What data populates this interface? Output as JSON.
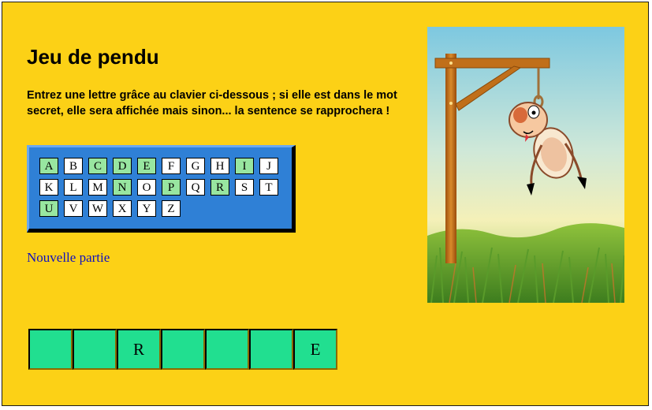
{
  "title": "Jeu de pendu",
  "instructions": "Entrez une lettre grâce au clavier ci-dessous ; si elle est dans le mot secret, elle sera affichée mais sinon... la sentence se rapprochera !",
  "keyboard": {
    "rows": [
      [
        {
          "letter": "A",
          "used": true
        },
        {
          "letter": "B",
          "used": false
        },
        {
          "letter": "C",
          "used": true
        },
        {
          "letter": "D",
          "used": true
        },
        {
          "letter": "E",
          "used": true
        },
        {
          "letter": "F",
          "used": false
        },
        {
          "letter": "G",
          "used": false
        },
        {
          "letter": "H",
          "used": false
        },
        {
          "letter": "I",
          "used": true
        },
        {
          "letter": "J",
          "used": false
        }
      ],
      [
        {
          "letter": "K",
          "used": false
        },
        {
          "letter": "L",
          "used": false
        },
        {
          "letter": "M",
          "used": false
        },
        {
          "letter": "N",
          "used": true
        },
        {
          "letter": "O",
          "used": false
        },
        {
          "letter": "P",
          "used": true
        },
        {
          "letter": "Q",
          "used": false
        },
        {
          "letter": "R",
          "used": true
        },
        {
          "letter": "S",
          "used": false
        },
        {
          "letter": "T",
          "used": false
        }
      ],
      [
        {
          "letter": "U",
          "used": true
        },
        {
          "letter": "V",
          "used": false
        },
        {
          "letter": "W",
          "used": false
        },
        {
          "letter": "X",
          "used": false
        },
        {
          "letter": "Y",
          "used": false
        },
        {
          "letter": "Z",
          "used": false
        }
      ]
    ]
  },
  "new_game_label": "Nouvelle partie",
  "word": [
    "",
    "",
    "R",
    "",
    "",
    "",
    "E"
  ],
  "hangman_stage": "full figure hanged",
  "colors": {
    "background": "#fcd116",
    "keyboard": "#2f80d6",
    "key_used": "#98e6a0",
    "word_slot": "#21df90",
    "link": "#1010c0"
  }
}
